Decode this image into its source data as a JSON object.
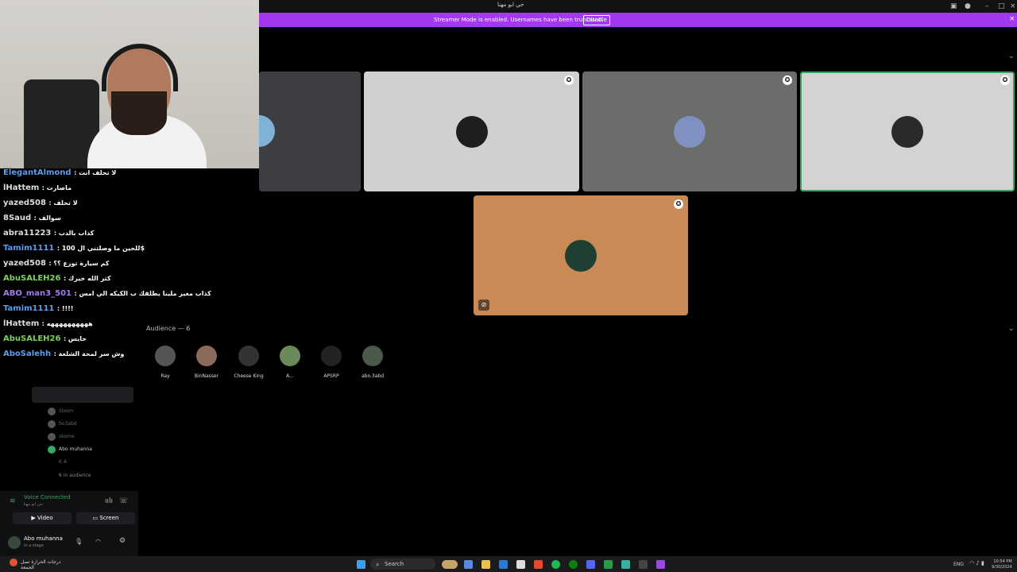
{
  "window": {
    "title": "حي ابو مهنا"
  },
  "banner": {
    "text": "Streamer Mode is enabled. Usernames have been truncated.",
    "disable_label": "Disable"
  },
  "chat": [
    {
      "user": "ElegantAlmond",
      "msg": ": لا تحلف انت",
      "color": "blue"
    },
    {
      "user": "lHattem",
      "msg": ": ماصارت",
      "color": "white"
    },
    {
      "user": "yazed508",
      "msg": ": لا تحلف",
      "color": "blue"
    },
    {
      "user": "8Saud",
      "msg": ": سوالف",
      "color": "blue"
    },
    {
      "user": "abra11223",
      "msg": ": كذاب بالدب",
      "color": "white"
    },
    {
      "user": "Tamim1111",
      "msg": ": للحين ما وصلتني ال 100$",
      "color": "blue"
    },
    {
      "user": "yazed508",
      "msg": ": كم سيارة توزع ؟؟",
      "color": "blue"
    },
    {
      "user": "AbuSALEH26",
      "msg": ": كثر الله خيرك",
      "color": "green"
    },
    {
      "user": "ABO_man3_501",
      "msg": ": كذاب مغير ملينا يطلقك ب الكيكه الي امس",
      "color": "purple"
    },
    {
      "user": "Tamim1111",
      "msg": ": !!!!",
      "color": "blue"
    },
    {
      "user": "lHattem",
      "msg": ": ههههههههههه",
      "color": "white"
    },
    {
      "user": "AbuSALEH26",
      "msg": ": خايس",
      "color": "green"
    },
    {
      "user": "AboSalehh",
      "msg": ": وش سر لمحة الشلعة",
      "color": "blue"
    }
  ],
  "sidebar": {
    "members": [
      "Sloom",
      "bo3abd",
      "skome",
      "Abo muhanna",
      "K A"
    ],
    "audience_count": "6 in audience"
  },
  "audience": {
    "header": "Audience — 6",
    "members": [
      "Ray",
      "BinNasser",
      "Cheese King",
      "A...",
      "APSRP",
      "abo.3abd"
    ]
  },
  "voice": {
    "status": "Voice Connected",
    "video_label": "Video",
    "screen_label": "Screen",
    "user_name": "Abo muhanna",
    "user_status": "In a stage"
  },
  "taskbar": {
    "search_label": "Search",
    "weather": "درجات الحرارة تصل",
    "weather_sub": "الجمعة",
    "lang": "ENG",
    "time": "10:54 PM",
    "date": "9/30/2024"
  },
  "colors": {
    "banner": "#a338f0",
    "tile_gray_light": "#d0d0d0",
    "tile_gray_dark": "#6b6d6a",
    "tile_orange": "#c98a55",
    "speaking_border": "#3ba55c"
  }
}
